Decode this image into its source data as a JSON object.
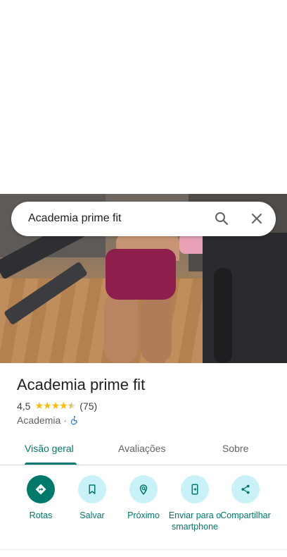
{
  "search": {
    "query": "Academia prime fit",
    "search_icon": "search-icon",
    "close_icon": "close-icon"
  },
  "place": {
    "name": "Academia prime fit",
    "rating": "4,5",
    "rating_value": 4.5,
    "review_count": "(75)",
    "category": "Academia",
    "separator": "·",
    "accessibility_icon": "wheelchair-icon"
  },
  "tabs": [
    {
      "label": "Visão geral",
      "active": true
    },
    {
      "label": "Avaliações",
      "active": false
    },
    {
      "label": "Sobre",
      "active": false
    }
  ],
  "actions": [
    {
      "label": "Rotas",
      "icon": "directions-icon"
    },
    {
      "label": "Salvar",
      "icon": "bookmark-icon"
    },
    {
      "label": "Próximo",
      "icon": "nearby-icon"
    },
    {
      "label": "Enviar para o smartphone",
      "icon": "send-to-phone-icon"
    },
    {
      "label": "Compartilhar",
      "icon": "share-icon"
    }
  ],
  "colors": {
    "accent": "#00796b",
    "action_bg": "#c8f2f7",
    "star": "#fbbc04"
  }
}
